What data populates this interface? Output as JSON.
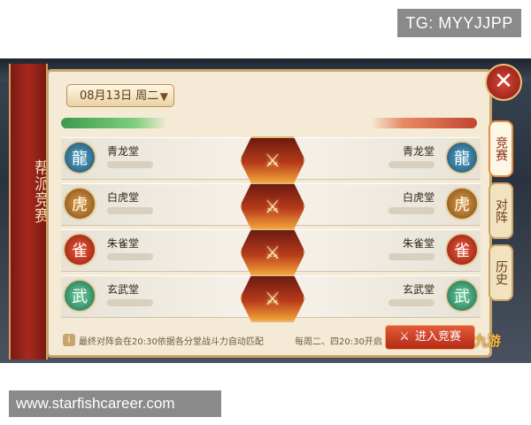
{
  "overlay": {
    "tg_label": "TG: MYYJJPP",
    "site_label": "www.starfishcareer.com"
  },
  "panel": {
    "left_banner_title": "帮派竞赛",
    "date_selector": "08月13日 周二",
    "close_glyph": "✕"
  },
  "tabs": [
    {
      "label": "竞赛",
      "active": true
    },
    {
      "label": "对阵",
      "active": false
    },
    {
      "label": "历史",
      "active": false
    }
  ],
  "matchups": [
    {
      "left": "青龙堂",
      "right": "青龙堂",
      "emblem": "dragon-emblem-icon"
    },
    {
      "left": "白虎堂",
      "right": "白虎堂",
      "emblem": "tiger-emblem-icon"
    },
    {
      "left": "朱雀堂",
      "right": "朱雀堂",
      "emblem": "phoenix-emblem-icon"
    },
    {
      "left": "玄武堂",
      "right": "玄武堂",
      "emblem": "tortoise-emblem-icon"
    }
  ],
  "footer": {
    "info_text": "最终对阵会在20:30依据各分堂战斗力自动匹配",
    "schedule_text": "每周二、四20:30开启",
    "enter_button": "进入竞赛",
    "watermark": "九游"
  },
  "colors": {
    "left_team": "#3b9a4c",
    "right_team": "#c2452f",
    "accent": "#c9a46a"
  }
}
